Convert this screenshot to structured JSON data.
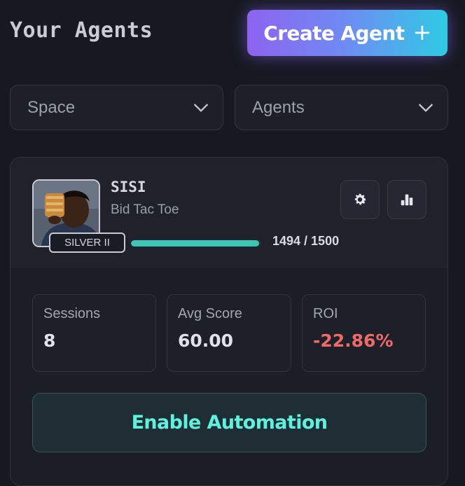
{
  "header": {
    "title": "Your Agents",
    "create_button": {
      "label": "Create Agent",
      "icon": "plus-icon"
    }
  },
  "filters": {
    "space": {
      "label": "Space",
      "icon": "chevron-down-icon"
    },
    "agents": {
      "label": "Agents",
      "icon": "chevron-down-icon"
    }
  },
  "agent": {
    "name": "SISI",
    "game": "Bid Tac Toe",
    "rank": "SILVER II",
    "xp_text": "1494 / 1500",
    "xp_fraction": 0.985,
    "actions": {
      "settings_icon": "gear-icon",
      "stats_icon": "bar-chart-icon"
    },
    "stats": [
      {
        "label": "Sessions",
        "value": "8"
      },
      {
        "label": "Avg Score",
        "value": "60.00"
      },
      {
        "label": "ROI",
        "value": "-22.86%"
      }
    ],
    "enable_button": "Enable Automation"
  },
  "colors": {
    "background": "#161922",
    "accent_purple": "#8d63f0",
    "accent_cyan": "#2ecbe4",
    "progress": "#3cc6b4",
    "negative": "#f06b67",
    "enable_text": "#5ff0e0"
  }
}
